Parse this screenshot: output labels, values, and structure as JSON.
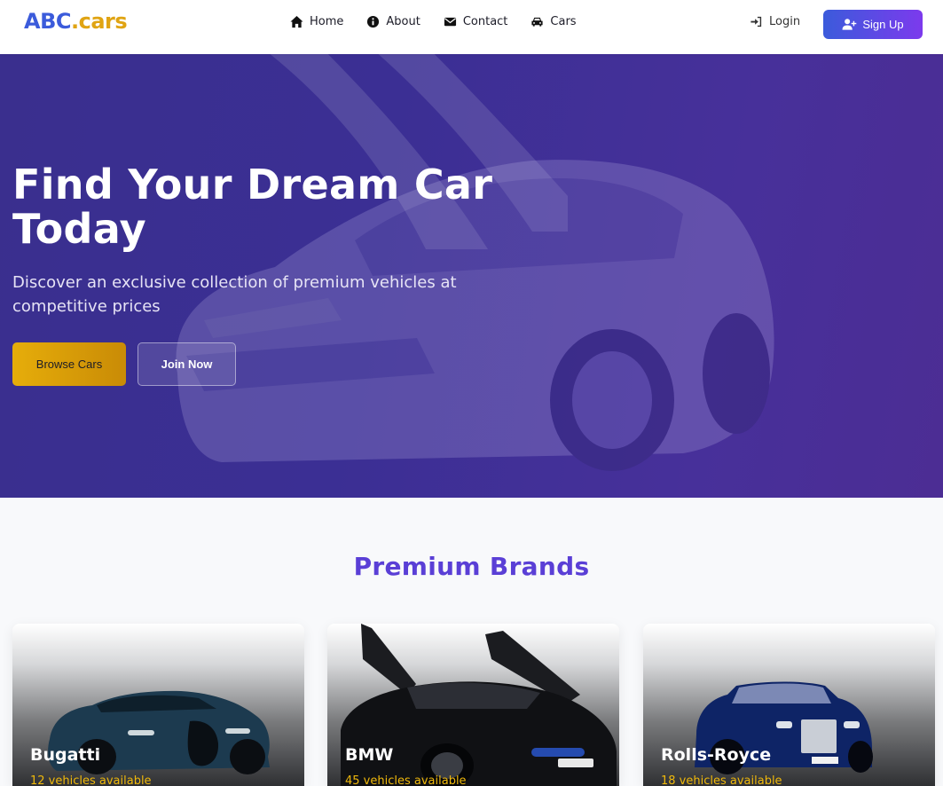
{
  "brand": {
    "abc": "ABC",
    "cars": ".cars"
  },
  "nav": {
    "links": [
      {
        "label": "Home",
        "icon": "home-icon"
      },
      {
        "label": "About",
        "icon": "info-icon"
      },
      {
        "label": "Contact",
        "icon": "envelope-icon"
      },
      {
        "label": "Cars",
        "icon": "car-icon"
      }
    ],
    "login": "Login",
    "signup": "Sign Up"
  },
  "hero": {
    "title": "Find Your Dream Car Today",
    "subtitle": "Discover an exclusive collection of premium vehicles at competitive prices",
    "browse": "Browse Cars",
    "join": "Join Now"
  },
  "brands": {
    "title": "Premium Brands",
    "cards": [
      {
        "name": "Bugatti",
        "count": "12 vehicles available"
      },
      {
        "name": "BMW",
        "count": "45 vehicles available"
      },
      {
        "name": "Rolls-Royce",
        "count": "18 vehicles available"
      }
    ]
  },
  "colors": {
    "accent_blue": "#3b5bdb",
    "accent_gold": "#e0a413",
    "purple": "#5a3fd6"
  }
}
